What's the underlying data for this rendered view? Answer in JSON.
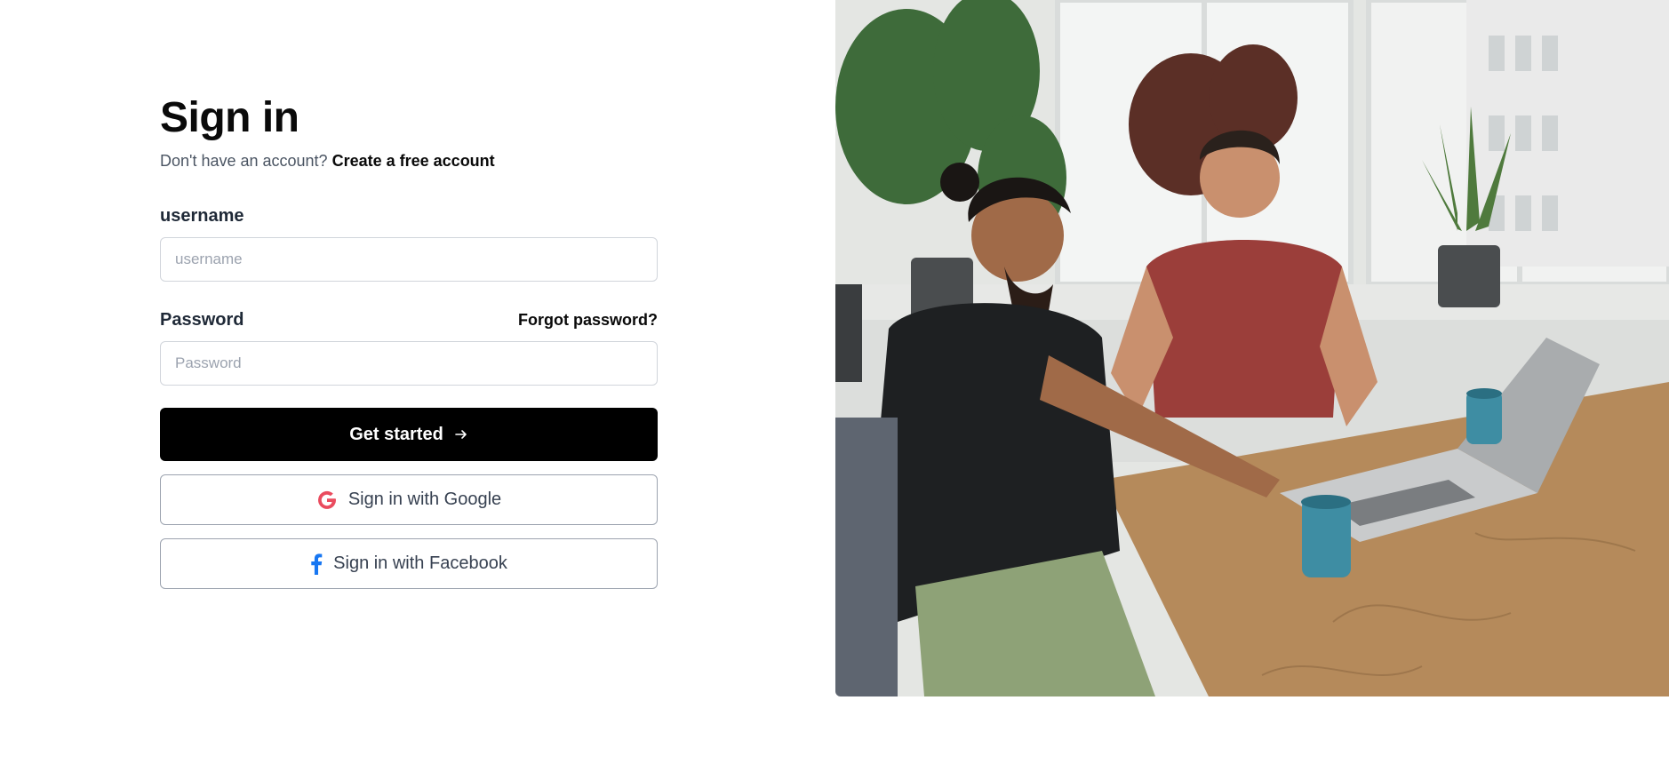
{
  "header": {
    "title": "Sign in",
    "subtitle_text": "Don't have an account?",
    "create_account_link": "Create a free account"
  },
  "form": {
    "username": {
      "label": "username",
      "placeholder": "username",
      "value": ""
    },
    "password": {
      "label": "Password",
      "placeholder": "Password",
      "value": "",
      "forgot_link": "Forgot password?"
    },
    "submit_label": "Get started",
    "submit_icon": "arrow-right-icon"
  },
  "social": {
    "google": {
      "label": "Sign in with Google",
      "icon": "google-icon",
      "color": "#ea4c5f"
    },
    "facebook": {
      "label": "Sign in with Facebook",
      "icon": "facebook-icon",
      "color": "#1877f2"
    }
  },
  "hero_image": {
    "subject": "two-people-working-at-laptop-photo"
  },
  "colors": {
    "primary_button": "#000000",
    "text_dark": "#0a0a0a",
    "text_muted": "#4b5563",
    "border": "#d1d5db"
  }
}
